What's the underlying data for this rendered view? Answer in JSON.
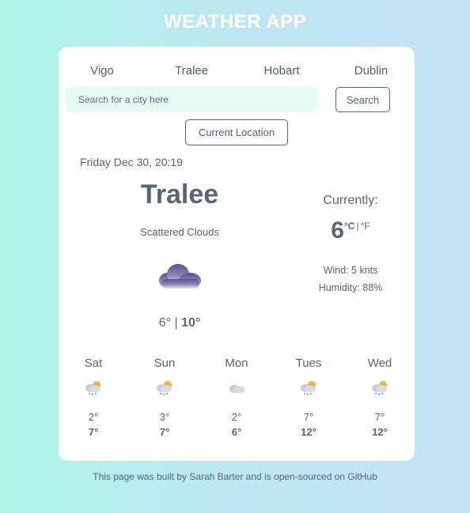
{
  "app": {
    "title": "WEATHER APP"
  },
  "cities": [
    "Vigo",
    "Tralee",
    "Hobart",
    "Dublin"
  ],
  "search": {
    "placeholder": "Search for a city here",
    "button_label": "Search"
  },
  "location_button_label": "Current Location",
  "current": {
    "date": "Friday Dec 30, 20:19",
    "city": "Tralee",
    "description": "Scattered Clouds",
    "icon": "scattered-clouds-icon",
    "min": "6°",
    "max": "10°",
    "separator": "|",
    "currently_label": "Currently:",
    "temperature": "6",
    "unit_c": "°C",
    "unit_separator": "|",
    "unit_f": "°F",
    "wind": "Wind: 5 knts",
    "humidity": "Humidity: 88%"
  },
  "forecast": [
    {
      "day": "Sat",
      "icon": "rain-sun-cloud-icon",
      "min": "2°",
      "max": "7°"
    },
    {
      "day": "Sun",
      "icon": "rain-sun-cloud-icon",
      "min": "3°",
      "max": "7°"
    },
    {
      "day": "Mon",
      "icon": "cloud-icon",
      "min": "2°",
      "max": "6°"
    },
    {
      "day": "Tues",
      "icon": "rain-sun-cloud-icon",
      "min": "7°",
      "max": "12°"
    },
    {
      "day": "Wed",
      "icon": "rain-sun-cloud-icon",
      "min": "7°",
      "max": "12°"
    }
  ],
  "footer": "This page was built by Sarah Barter and is open-sourced on GitHub",
  "colors": {
    "text": "#56657a",
    "card": "#ffffff",
    "search_bg": "#e6fbf5",
    "bg_start": "#aef5e6",
    "bg_end": "#c3e3f6"
  }
}
